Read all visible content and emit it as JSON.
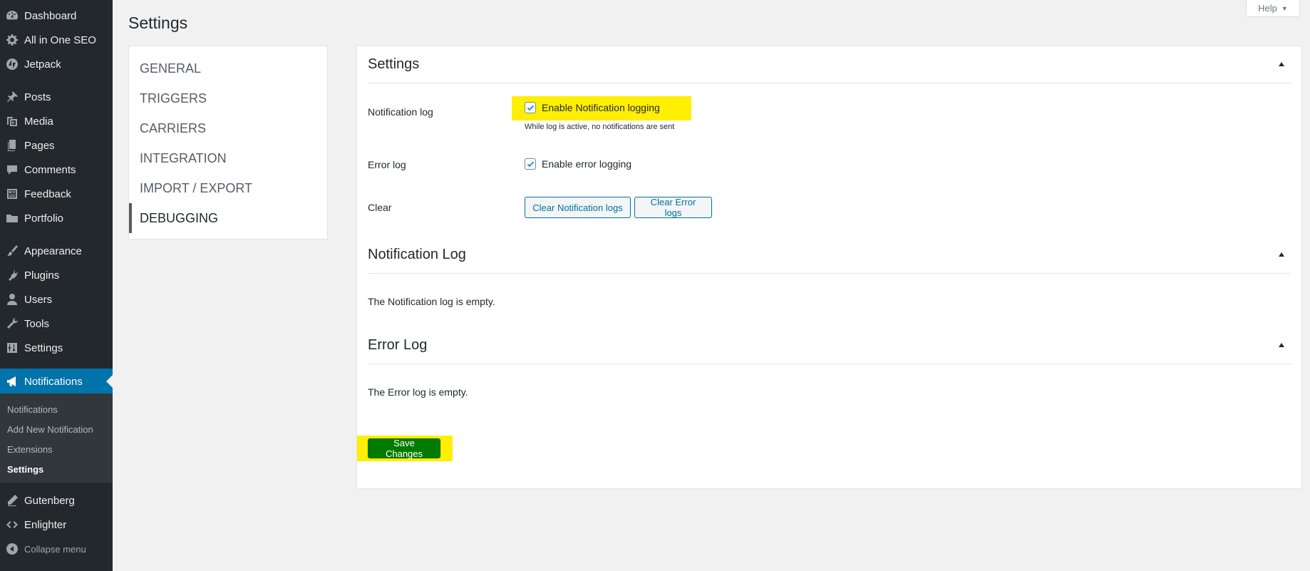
{
  "sidebar": {
    "items": [
      {
        "label": "Dashboard",
        "icon": "dashboard-icon"
      },
      {
        "label": "All in One SEO",
        "icon": "gear-icon"
      },
      {
        "label": "Jetpack",
        "icon": "jetpack-icon"
      },
      {
        "label": "Posts",
        "icon": "pin-icon"
      },
      {
        "label": "Media",
        "icon": "media-icon"
      },
      {
        "label": "Pages",
        "icon": "pages-icon"
      },
      {
        "label": "Comments",
        "icon": "comment-icon"
      },
      {
        "label": "Feedback",
        "icon": "feedback-icon"
      },
      {
        "label": "Portfolio",
        "icon": "folder-icon"
      },
      {
        "label": "Appearance",
        "icon": "paintbrush-icon"
      },
      {
        "label": "Plugins",
        "icon": "plug-icon"
      },
      {
        "label": "Users",
        "icon": "user-icon"
      },
      {
        "label": "Tools",
        "icon": "wrench-icon"
      },
      {
        "label": "Settings",
        "icon": "settings-sliders-icon"
      },
      {
        "label": "Notifications",
        "icon": "megaphone-icon"
      },
      {
        "label": "Gutenberg",
        "icon": "pen-icon"
      },
      {
        "label": "Enlighter",
        "icon": "code-icon"
      },
      {
        "label": "Collapse menu",
        "icon": "collapse-arrow-icon"
      }
    ],
    "submenu": [
      "Notifications",
      "Add New Notification",
      "Extensions",
      "Settings"
    ]
  },
  "help": {
    "label": "Help"
  },
  "page_title": "Settings",
  "tabs": [
    "GENERAL",
    "TRIGGERS",
    "CARRIERS",
    "INTEGRATION",
    "IMPORT / EXPORT",
    "DEBUGGING"
  ],
  "active_tab": "DEBUGGING",
  "settings_section": {
    "title": "Settings",
    "notification_log_label": "Notification log",
    "notification_log_checkbox": "Enable Notification logging",
    "notification_log_checked": true,
    "notification_log_desc": "While log is active, no notifications are sent",
    "error_log_label": "Error log",
    "error_log_checkbox": "Enable error logging",
    "error_log_checked": true,
    "clear_label": "Clear",
    "clear_notification_button": "Clear Notification logs",
    "clear_error_button": "Clear Error logs"
  },
  "notification_log_section": {
    "title": "Notification Log",
    "empty_text": "The Notification log is empty."
  },
  "error_log_section": {
    "title": "Error Log",
    "empty_text": "The Error log is empty."
  },
  "save_button": "Save Changes",
  "colors": {
    "sidebar_bg": "#23282d",
    "active_menu": "#0073aa",
    "highlight": "#ffef00",
    "save_button": "#007b00",
    "secondary_button_text": "#0071a1"
  }
}
